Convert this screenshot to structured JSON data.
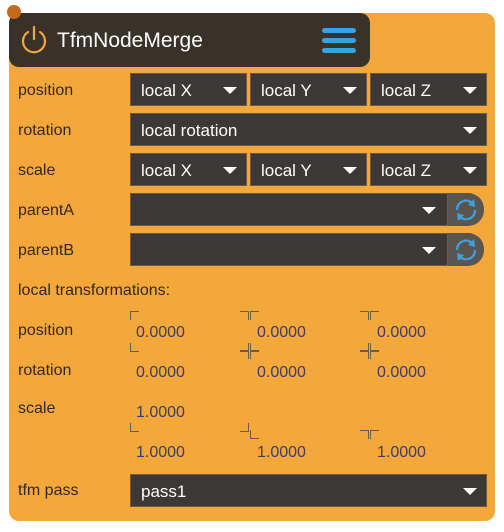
{
  "header": {
    "title": "TfmNodeMerge",
    "icons": {
      "power": "power-icon",
      "menu": "hamburger-menu-icon"
    },
    "colors": {
      "panel": "#f4a73a",
      "header": "#3a3129",
      "accent": "#3da0e0"
    }
  },
  "position": {
    "label": "position",
    "x": "local X",
    "y": "local Y",
    "z": "local Z"
  },
  "rotation": {
    "label": "rotation",
    "value": "local rotation"
  },
  "scale": {
    "label": "scale",
    "x": "local X",
    "y": "local Y",
    "z": "local Z"
  },
  "parentA": {
    "label": "parentA",
    "value": ""
  },
  "parentB": {
    "label": "parentB",
    "value": ""
  },
  "local": {
    "heading": "local transformations:",
    "position": {
      "label": "position",
      "x": "0.0000",
      "y": "0.0000",
      "z": "0.0000"
    },
    "rotation": {
      "label": "rotation",
      "x": "0.0000",
      "y": "0.0000",
      "z": "0.0000"
    },
    "scale": {
      "label": "scale",
      "w": "1.0000",
      "x": "1.0000",
      "y": "1.0000",
      "z": "1.0000"
    }
  },
  "tfm_pass": {
    "label": "tfm pass",
    "value": "pass1"
  }
}
